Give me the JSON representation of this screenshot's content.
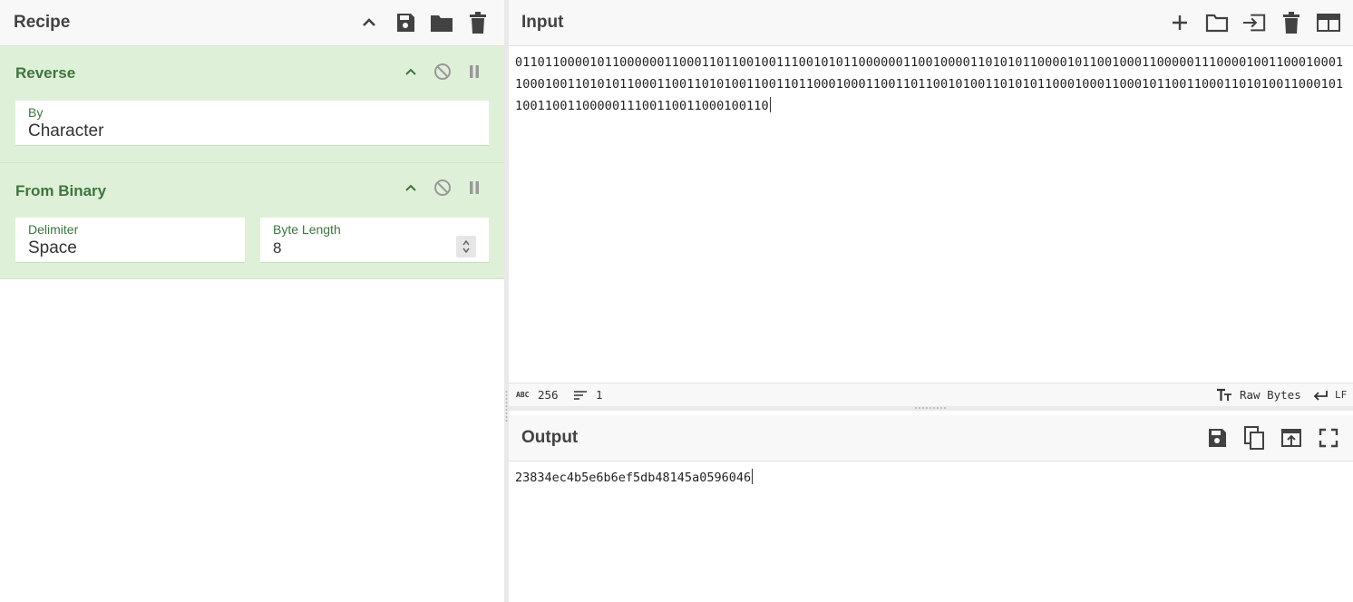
{
  "recipe": {
    "title": "Recipe",
    "operations": [
      {
        "name": "Reverse",
        "args": [
          {
            "label": "By",
            "value": "Character"
          }
        ]
      },
      {
        "name": "From Binary",
        "args": [
          {
            "label": "Delimiter",
            "value": "Space"
          },
          {
            "label": "Byte Length",
            "value": "8"
          }
        ]
      }
    ]
  },
  "input": {
    "title": "Input",
    "text": "0110110000101100000011000110110010011100101011000000110010000110101011000010110010001100000111000010011000100011000100110101011000110011010100110011011000100011001101100101001101010110001000110001011001100011010100110001011001100110000011100110011000100110",
    "status": {
      "char_count": "256",
      "line_count": "1",
      "encoding": "Raw Bytes",
      "eol": "LF",
      "abc_label": "ABC"
    }
  },
  "output": {
    "title": "Output",
    "text": "23834ec4b5e6b6ef5db48145a0596046"
  },
  "colors": {
    "op_background": "#dff0d8",
    "op_title": "#3c763d",
    "header_background": "#f8f8f8"
  }
}
